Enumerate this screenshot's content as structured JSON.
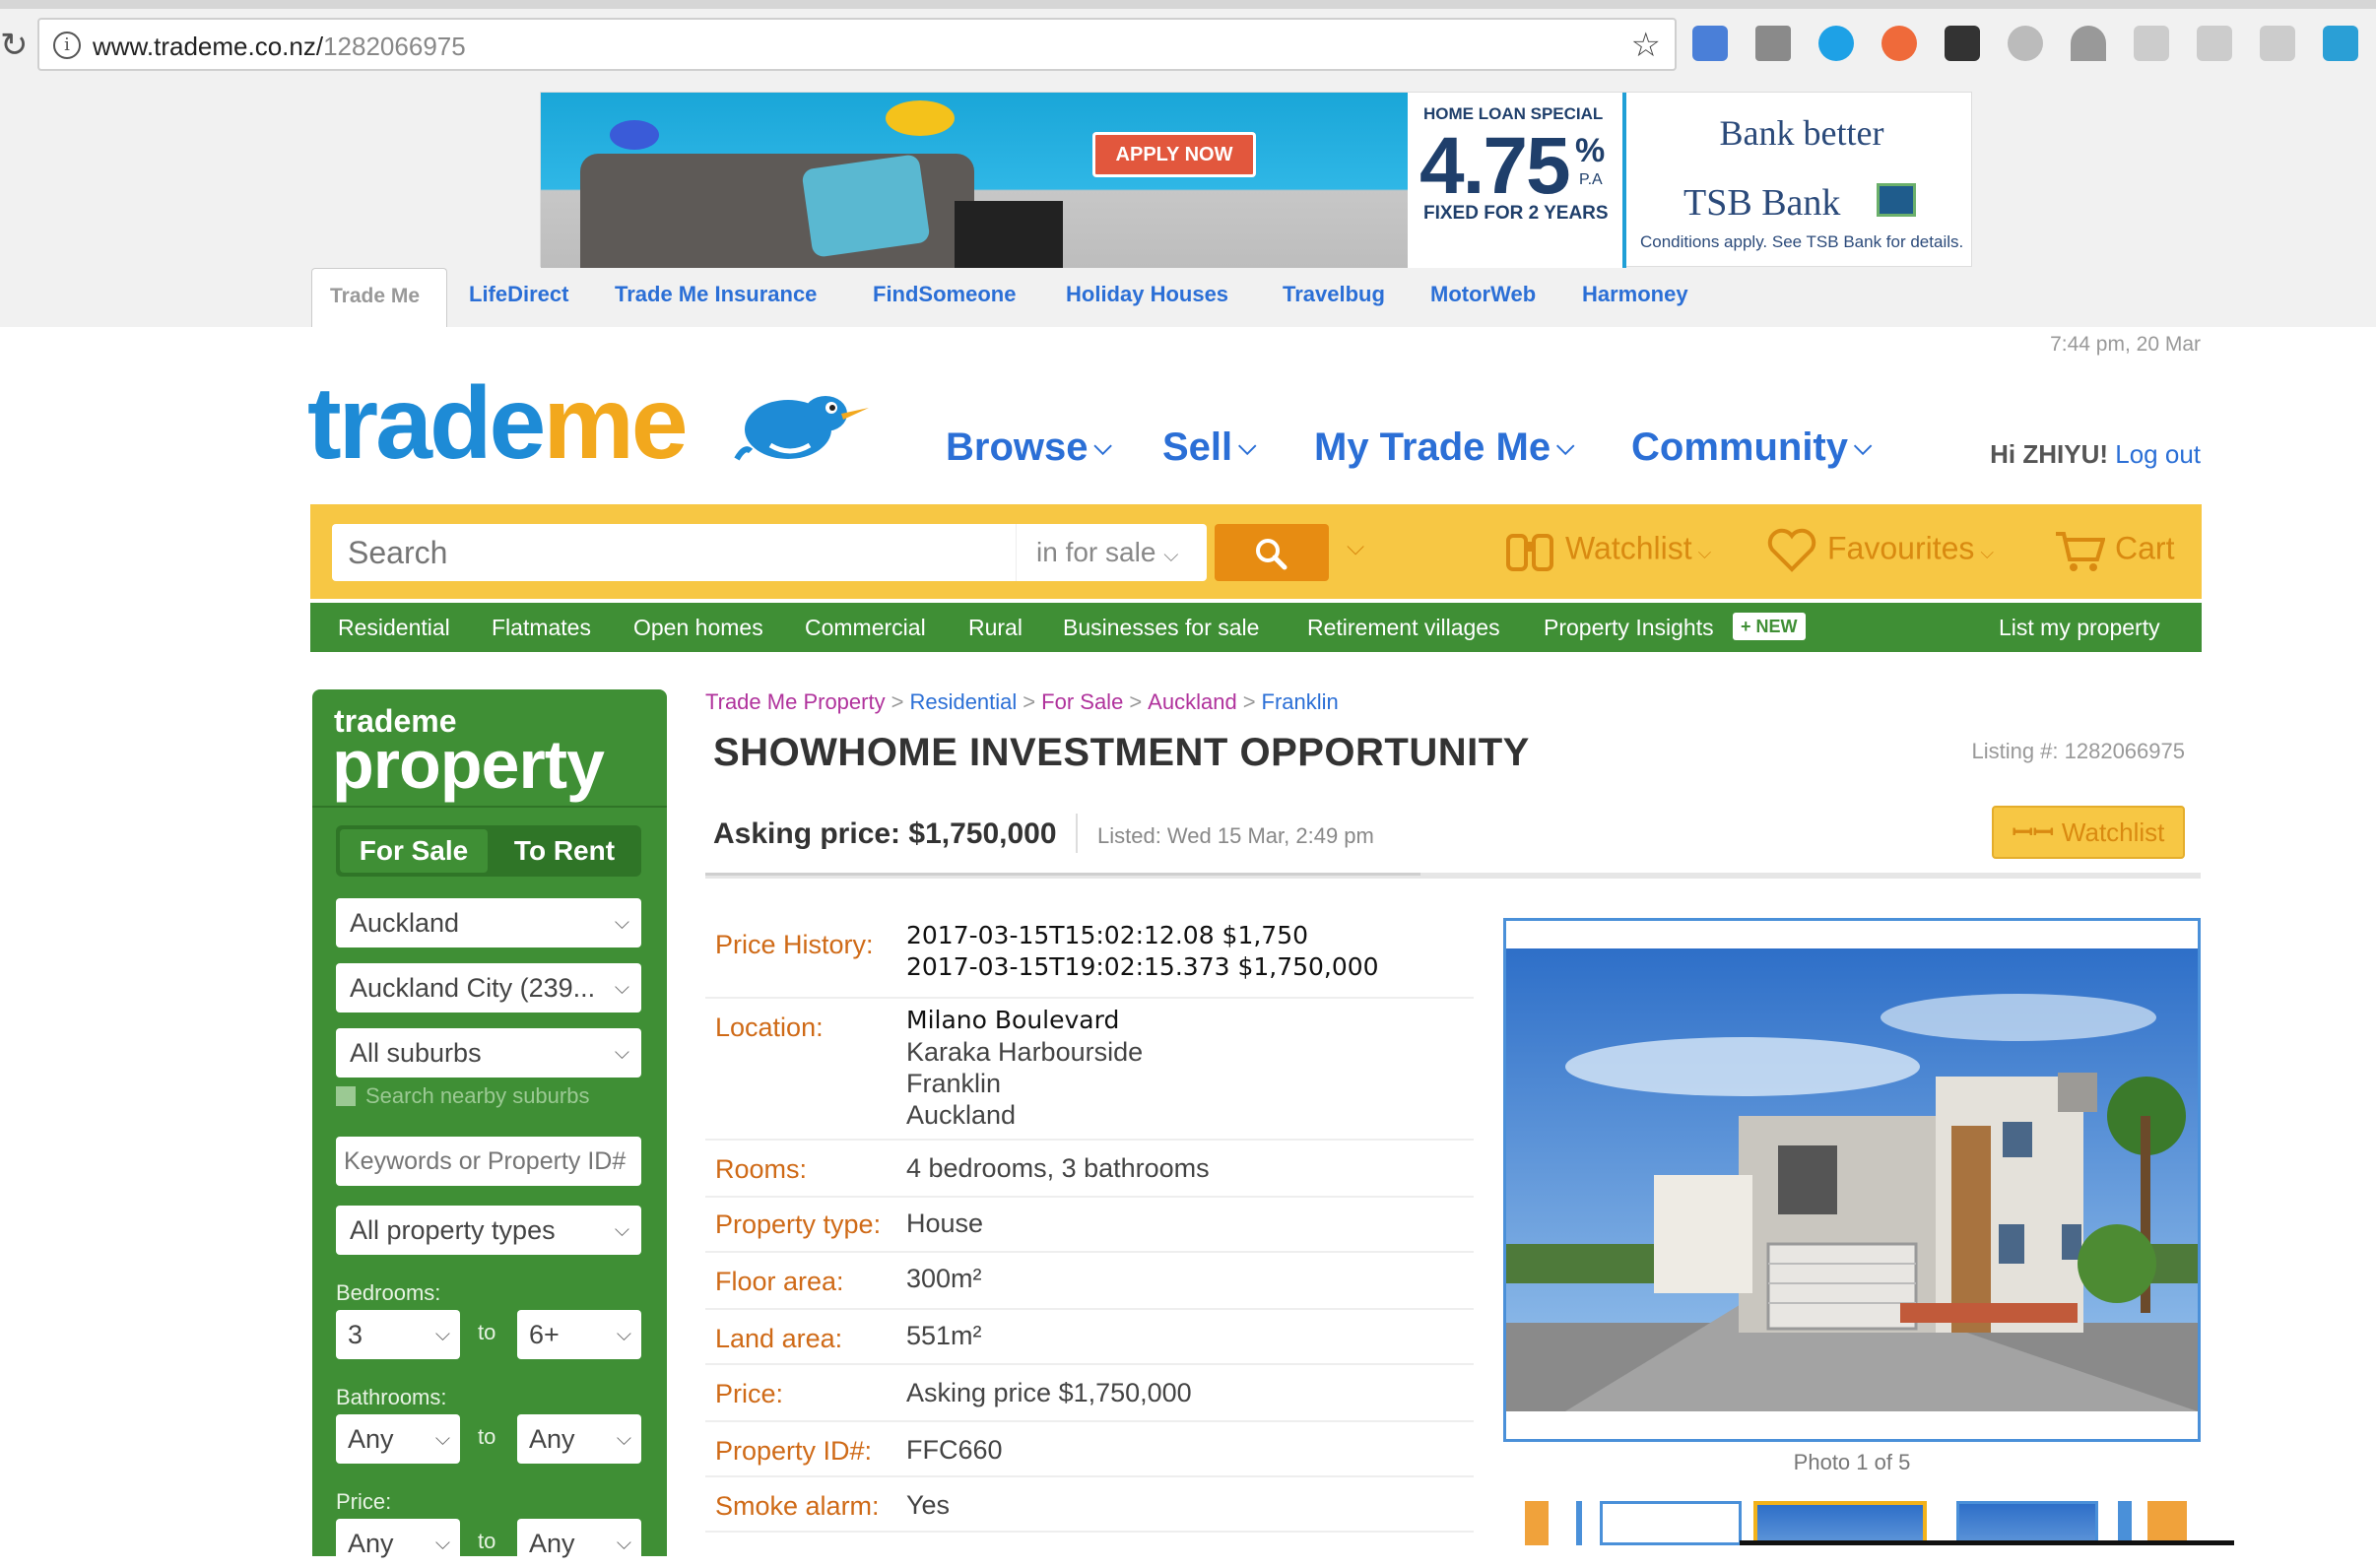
{
  "browser": {
    "url_domain": "www.trademe.co.nz/",
    "url_path": "1282066975"
  },
  "ad": {
    "apply_label": "APPLY NOW",
    "rate_top": "HOME LOAN SPECIAL",
    "rate": "4.75",
    "rate_pct": "%",
    "rate_pa": "P.A",
    "rate_bottom": "FIXED FOR 2 YEARS",
    "bank_tagline": "Bank better",
    "bank_name": "TSB Bank",
    "conditions": "Conditions apply. See TSB Bank for details."
  },
  "network_tabs": [
    "Trade Me",
    "LifeDirect",
    "Trade Me Insurance",
    "FindSomeone",
    "Holiday Houses",
    "Travelbug",
    "MotorWeb",
    "Harmoney"
  ],
  "clock": "7:44 pm, 20 Mar",
  "header": {
    "logo_trade": "trade",
    "logo_me": "me",
    "nav": [
      "Browse",
      "Sell",
      "My Trade Me",
      "Community"
    ],
    "greeting": "Hi ZHIYU!",
    "logout": "Log out"
  },
  "search": {
    "placeholder": "Search",
    "scope": "in for sale",
    "watchlist": "Watchlist",
    "favourites": "Favourites",
    "cart": "Cart"
  },
  "subnav": {
    "items": [
      "Residential",
      "Flatmates",
      "Open homes",
      "Commercial",
      "Rural",
      "Businesses for sale",
      "Retirement villages",
      "Property Insights"
    ],
    "new_badge": "+ NEW",
    "list_property": "List my property"
  },
  "sidebar": {
    "brand_small": "trademe",
    "brand_big": "property",
    "tab_sale": "For Sale",
    "tab_rent": "To Rent",
    "region": "Auckland",
    "district": "Auckland City (239...",
    "suburb": "All suburbs",
    "nearby": "Search nearby suburbs",
    "keywords_placeholder": "Keywords or Property ID#",
    "property_type": "All property types",
    "bedrooms_label": "Bedrooms:",
    "bedrooms_from": "3",
    "bedrooms_to": "6+",
    "bathrooms_label": "Bathrooms:",
    "bathrooms_from": "Any",
    "bathrooms_to": "Any",
    "price_label": "Price:",
    "price_from": "Any",
    "price_to": "Any",
    "to": "to"
  },
  "listing": {
    "breadcrumb": [
      "Trade Me Property",
      "Residential",
      "For Sale",
      "Auckland",
      "Franklin"
    ],
    "title": "SHOWHOME INVESTMENT OPPORTUNITY",
    "listing_no": "Listing #: 1282066975",
    "asking_price": "Asking price: $1,750,000",
    "listed": "Listed: Wed 15 Mar, 2:49 pm",
    "watchlist_btn": "Watchlist",
    "photo_caption": "Photo 1 of 5",
    "attributes": [
      {
        "label": "Price History:",
        "lines": [
          "2017-03-15T15:02:12.08 $1,750",
          "2017-03-15T19:02:15.373 $1,750,000"
        ]
      },
      {
        "label": "Location:",
        "lines": [
          "Milano Boulevard",
          "Karaka Harbourside",
          "Franklin",
          "Auckland"
        ]
      },
      {
        "label": "Rooms:",
        "lines": [
          "4 bedrooms, 3 bathrooms"
        ]
      },
      {
        "label": "Property type:",
        "lines": [
          "House"
        ]
      },
      {
        "label": "Floor area:",
        "lines": [
          "300m²"
        ]
      },
      {
        "label": "Land area:",
        "lines": [
          "551m²"
        ]
      },
      {
        "label": "Price:",
        "lines": [
          "Asking price $1,750,000"
        ]
      },
      {
        "label": "Property ID#:",
        "lines": [
          "FFC660"
        ]
      },
      {
        "label": "Smoke alarm:",
        "lines": [
          "Yes"
        ]
      }
    ]
  },
  "colors": {
    "brand_blue": "#1e8bd6",
    "brand_orange": "#f2a81d",
    "search_yellow": "#f7c744",
    "property_green": "#3f8f35",
    "attr_label": "#cf6a17"
  }
}
